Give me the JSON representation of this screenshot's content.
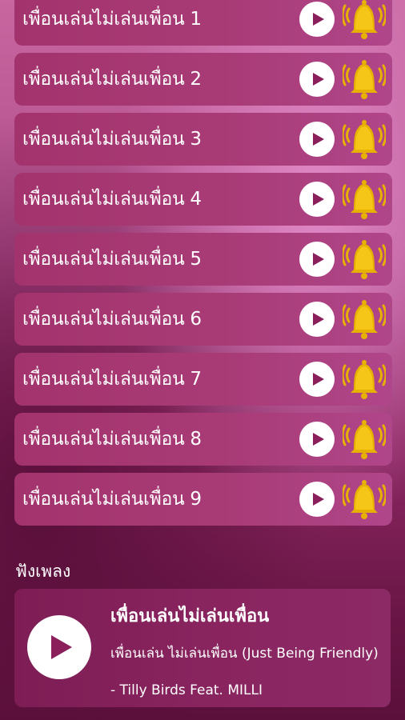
{
  "ringtones": [
    {
      "label": "เพื่อนเล่นไม่เล่นเพื่อน 1"
    },
    {
      "label": "เพื่อนเล่นไม่เล่นเพื่อน 2"
    },
    {
      "label": "เพื่อนเล่นไม่เล่นเพื่อน 3"
    },
    {
      "label": "เพื่อนเล่นไม่เล่นเพื่อน 4"
    },
    {
      "label": "เพื่อนเล่นไม่เล่นเพื่อน 5"
    },
    {
      "label": "เพื่อนเล่นไม่เล่นเพื่อน 6"
    },
    {
      "label": "เพื่อนเล่นไม่เล่นเพื่อน 7"
    },
    {
      "label": "เพื่อนเล่นไม่เล่นเพื่อน 8"
    },
    {
      "label": "เพื่อนเล่นไม่เล่นเพื่อน 9"
    }
  ],
  "icons": {
    "play": "play-icon",
    "bell": "bell-icon"
  },
  "listen": {
    "section_title": "ฟังเพลง",
    "song_title": "เพื่อนเล่นไม่เล่นเพื่อน",
    "song_subtitle": "เพื่อนเล่น ไม่เล่นเพื่อน (Just Being Friendly) - Tilly Birds Feat. MILLI"
  },
  "colors": {
    "row_bg": "#a3336d",
    "card_bg": "#7e1d55",
    "play_glyph": "#8a1f5c",
    "bell_gold": "#e6b100"
  }
}
